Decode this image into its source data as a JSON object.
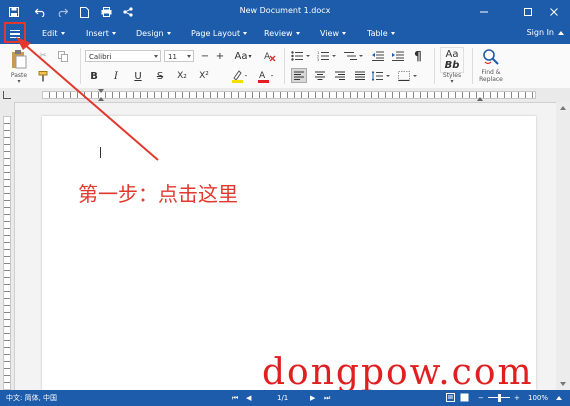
{
  "window": {
    "title": "New Document 1.docx",
    "sign_in": "Sign In"
  },
  "menu": {
    "items": [
      "Edit",
      "Insert",
      "Design",
      "Page Layout",
      "Review",
      "View",
      "Table"
    ]
  },
  "ribbon": {
    "paste_label": "Paste",
    "font_name": "Calibri",
    "font_size": "11",
    "font_size_decrease": "−",
    "font_size_increase": "+",
    "change_case": "Aa",
    "styles_preview": "Aa\nBb",
    "styles_top": "Aa",
    "styles_bottom": "Bb",
    "styles_label": "Styles",
    "find_replace_label_1": "Find &",
    "find_replace_label_2": "Replace",
    "bold": "B",
    "italic": "I",
    "underline": "U",
    "strikethrough": "S",
    "subscript": "X₂",
    "superscript": "X²",
    "font_color_letter": "A",
    "pilcrow": "¶"
  },
  "colors": {
    "accent": "#1d5cab",
    "annotation": "#e2382d",
    "highlight_yellow": "#f5e000",
    "font_color_red": "#e02020"
  },
  "document": {
    "annotation_text": "第一步：点击这里"
  },
  "status": {
    "language": "中文: 简体, 中国",
    "page": "1/1",
    "zoom": "100%"
  },
  "watermark": "dongpow.com"
}
